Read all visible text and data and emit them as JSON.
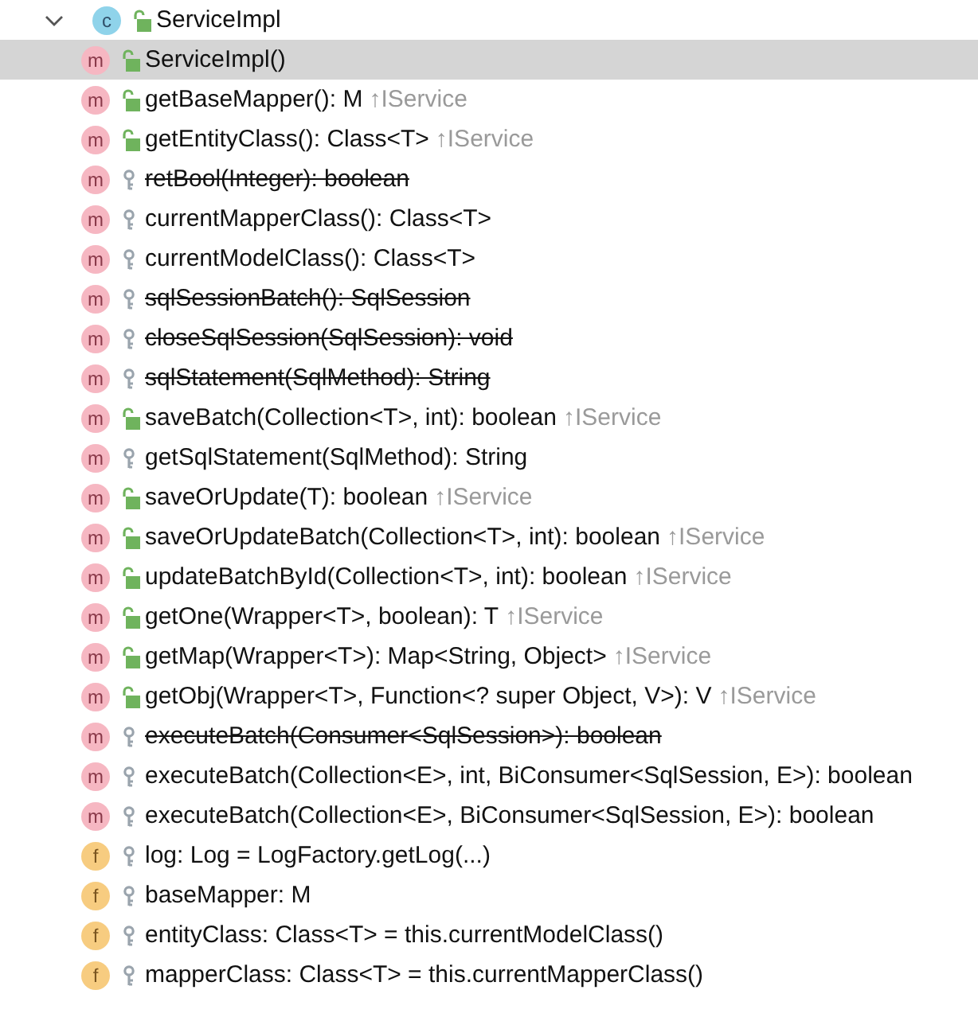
{
  "tree": {
    "label": "ServiceImpl",
    "icon_letter": "c",
    "kind": "class",
    "public": true,
    "expanded": true,
    "selected": false,
    "children": [
      {
        "kind": "method",
        "icon_letter": "m",
        "public": true,
        "label": "ServiceImpl()",
        "deprecated": false,
        "selected": true
      },
      {
        "kind": "method",
        "icon_letter": "m",
        "public": true,
        "label": "getBaseMapper(): M",
        "origin": "↑IService",
        "deprecated": false,
        "selected": false
      },
      {
        "kind": "method",
        "icon_letter": "m",
        "public": true,
        "label": "getEntityClass(): Class<T>",
        "origin": "↑IService",
        "deprecated": false,
        "selected": false
      },
      {
        "kind": "method",
        "icon_letter": "m",
        "public": false,
        "label": "retBool(Integer): boolean",
        "deprecated": true,
        "selected": false
      },
      {
        "kind": "method",
        "icon_letter": "m",
        "public": false,
        "label": "currentMapperClass(): Class<T>",
        "deprecated": false,
        "selected": false
      },
      {
        "kind": "method",
        "icon_letter": "m",
        "public": false,
        "label": "currentModelClass(): Class<T>",
        "deprecated": false,
        "selected": false
      },
      {
        "kind": "method",
        "icon_letter": "m",
        "public": false,
        "label": "sqlSessionBatch(): SqlSession",
        "deprecated": true,
        "selected": false
      },
      {
        "kind": "method",
        "icon_letter": "m",
        "public": false,
        "label": "closeSqlSession(SqlSession): void",
        "deprecated": true,
        "selected": false
      },
      {
        "kind": "method",
        "icon_letter": "m",
        "public": false,
        "label": "sqlStatement(SqlMethod): String",
        "deprecated": true,
        "selected": false
      },
      {
        "kind": "method",
        "icon_letter": "m",
        "public": true,
        "label": "saveBatch(Collection<T>, int): boolean",
        "origin": "↑IService",
        "deprecated": false,
        "selected": false
      },
      {
        "kind": "method",
        "icon_letter": "m",
        "public": false,
        "label": "getSqlStatement(SqlMethod): String",
        "deprecated": false,
        "selected": false
      },
      {
        "kind": "method",
        "icon_letter": "m",
        "public": true,
        "label": "saveOrUpdate(T): boolean",
        "origin": "↑IService",
        "deprecated": false,
        "selected": false
      },
      {
        "kind": "method",
        "icon_letter": "m",
        "public": true,
        "label": "saveOrUpdateBatch(Collection<T>, int): boolean",
        "origin": "↑IService",
        "deprecated": false,
        "selected": false
      },
      {
        "kind": "method",
        "icon_letter": "m",
        "public": true,
        "label": "updateBatchById(Collection<T>, int): boolean",
        "origin": "↑IService",
        "deprecated": false,
        "selected": false
      },
      {
        "kind": "method",
        "icon_letter": "m",
        "public": true,
        "label": "getOne(Wrapper<T>, boolean): T",
        "origin": "↑IService",
        "deprecated": false,
        "selected": false
      },
      {
        "kind": "method",
        "icon_letter": "m",
        "public": true,
        "label": "getMap(Wrapper<T>): Map<String, Object>",
        "origin": "↑IService",
        "deprecated": false,
        "selected": false
      },
      {
        "kind": "method",
        "icon_letter": "m",
        "public": true,
        "label": "getObj(Wrapper<T>, Function<? super Object, V>): V",
        "origin": "↑IService",
        "deprecated": false,
        "selected": false
      },
      {
        "kind": "method",
        "icon_letter": "m",
        "public": false,
        "label": "executeBatch(Consumer<SqlSession>): boolean",
        "deprecated": true,
        "selected": false
      },
      {
        "kind": "method",
        "icon_letter": "m",
        "public": false,
        "label": "executeBatch(Collection<E>, int, BiConsumer<SqlSession, E>): boolean",
        "deprecated": false,
        "selected": false
      },
      {
        "kind": "method",
        "icon_letter": "m",
        "public": false,
        "label": "executeBatch(Collection<E>, BiConsumer<SqlSession, E>): boolean",
        "deprecated": false,
        "selected": false
      },
      {
        "kind": "field",
        "icon_letter": "f",
        "public": false,
        "label": "log: Log = LogFactory.getLog(...)",
        "deprecated": false,
        "selected": false
      },
      {
        "kind": "field",
        "icon_letter": "f",
        "public": false,
        "label": "baseMapper: M",
        "deprecated": false,
        "selected": false
      },
      {
        "kind": "field",
        "icon_letter": "f",
        "public": false,
        "label": "entityClass: Class<T> = this.currentModelClass()",
        "deprecated": false,
        "selected": false
      },
      {
        "kind": "field",
        "icon_letter": "f",
        "public": false,
        "label": "mapperClass: Class<T> = this.currentMapperClass()",
        "deprecated": false,
        "selected": false
      }
    ]
  }
}
